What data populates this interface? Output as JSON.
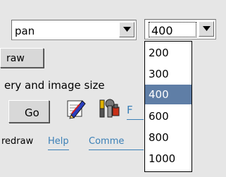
{
  "mode_combo": {
    "value": "pan"
  },
  "size_combo": {
    "value": "400",
    "options": [
      "200",
      "300",
      "400",
      "600",
      "800",
      "1000"
    ],
    "selected_index": 2
  },
  "buttons": {
    "redraw": "raw",
    "go": "Go"
  },
  "query_label": "ery and image size",
  "footer": {
    "redraw_text": "redraw",
    "help_link": "Help",
    "comments_link": "Comme"
  },
  "f_link": "F",
  "colors": {
    "selection": "#5f7ea6",
    "link": "#3a7fb6",
    "background": "#e6e6e6"
  },
  "icons": [
    "edit-icon",
    "tools-icon",
    "chevron-down-icon"
  ]
}
